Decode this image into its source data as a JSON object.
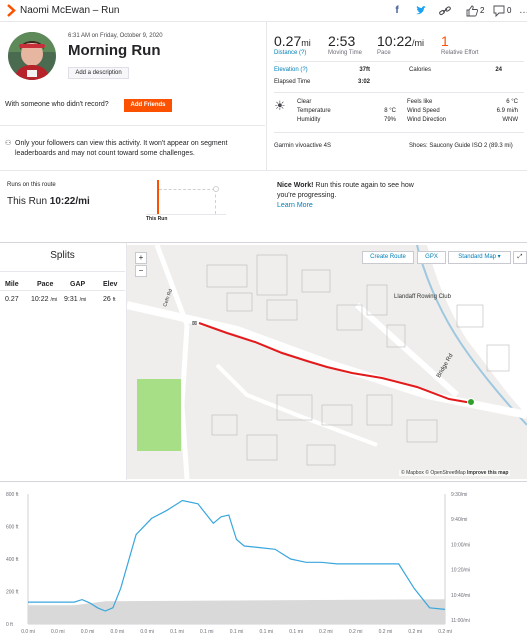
{
  "header": {
    "title": "Naomi McEwan – Run",
    "kudos_count": "2",
    "comment_count": "0"
  },
  "activity": {
    "datetime": "6:31 AM on Friday, October 9, 2020",
    "title": "Morning Run",
    "add_description": "Add a description",
    "with_someone": "With someone who didn't record?",
    "add_friends": "Add Friends",
    "privacy_note": "Only your followers can view this activity. It won't appear on segment leaderboards and may not count toward some challenges."
  },
  "stats": {
    "distance_value": "0.27",
    "distance_unit": "mi",
    "distance_label": "Distance (?)",
    "moving_time_value": "2:53",
    "moving_time_label": "Moving Time",
    "pace_value": "10:22",
    "pace_unit": "/mi",
    "pace_label": "Pace",
    "effort_value": "1",
    "effort_label": "Relative Effort",
    "elevation_label": "Elevation (?)",
    "elevation_value": "37ft",
    "calories_label": "Calories",
    "calories_value": "24",
    "elapsed_label": "Elapsed Time",
    "elapsed_value": "3:02"
  },
  "weather": {
    "condition": "Clear",
    "temperature_label": "Temperature",
    "temperature_value": "8 °C",
    "humidity_label": "Humidity",
    "humidity_value": "79%",
    "feels_label": "Feels like",
    "feels_value": "6 °C",
    "wind_speed_label": "Wind Speed",
    "wind_speed_value": "6.9 mi/h",
    "wind_dir_label": "Wind Direction",
    "wind_dir_value": "WNW",
    "icon": "weather-icon"
  },
  "gear": {
    "device": "Garmin vívoactive 4S",
    "shoes": "Shoes: Saucony Guide ISO 2 (89.3 mi)"
  },
  "route_compare": {
    "runs_on_route": "Runs on this route",
    "this_run_label": "This Run",
    "this_run_pace": "10:22/mi",
    "bar_label": "This Run",
    "nice_work_bold": "Nice Work!",
    "nice_work_text": "Run this route again to see how you're progressing.",
    "learn_more": "Learn More"
  },
  "splits": {
    "title": "Splits",
    "headers": [
      "Mile",
      "Pace",
      "GAP",
      "Elev"
    ],
    "rows": [
      {
        "mile": "0.27",
        "pace": "10:22",
        "pace_unit": "/mi",
        "gap": "9:31",
        "gap_unit": "/mi",
        "elev": "26",
        "elev_unit": "ft"
      }
    ]
  },
  "map": {
    "create_route": "Create Route",
    "gpx": "GPX",
    "map_type": "Standard Map",
    "zoom_in": "+",
    "zoom_out": "−",
    "labels": {
      "road1": "Cefn Rd",
      "road2": "Bridge Rd",
      "club": "Llandaff Rowing Club"
    },
    "attribution": "© Mapbox © OpenStreetMap",
    "improve": "Improve this map"
  },
  "chart_data": {
    "type": "area",
    "title": "",
    "series": [
      {
        "name": "",
        "x": [
          0.0,
          0.01,
          0.02,
          0.03,
          0.035,
          0.04,
          0.045,
          0.05,
          0.055,
          0.06,
          0.07,
          0.08,
          0.09,
          0.1,
          0.11,
          0.12,
          0.125,
          0.13,
          0.135,
          0.14,
          0.15,
          0.16,
          0.17,
          0.18,
          0.19,
          0.2,
          0.21,
          0.22,
          0.23,
          0.24,
          0.25,
          0.26,
          0.27
        ],
        "values": [
          135,
          135,
          135,
          135,
          150,
          130,
          100,
          80,
          100,
          220,
          550,
          650,
          700,
          760,
          740,
          620,
          660,
          670,
          520,
          480,
          470,
          460,
          400,
          380,
          380,
          370,
          370,
          370,
          370,
          370,
          220,
          100,
          90
        ]
      }
    ],
    "left_axis": {
      "unit": "ft",
      "ticks": [
        "0 ft",
        "200 ft",
        "400 ft",
        "600 ft",
        "800 ft"
      ],
      "ylim": [
        0,
        800
      ]
    },
    "right_axis": {
      "unit": "/mi",
      "ticks": [
        "9:30/mi",
        "9:40/mi",
        "10:00/mi",
        "10:20/mi",
        "10:40/mi",
        "11:00/mi"
      ]
    },
    "x_ticks": [
      "0.0 mi",
      "0.0 mi",
      "0.0 mi",
      "0.0 mi",
      "0.0 mi",
      "0.1 mi",
      "0.1 mi",
      "0.1 mi",
      "0.1 mi",
      "0.1 mi",
      "0.2 mi",
      "0.2 mi",
      "0.2 mi",
      "0.2 mi",
      "0.2 mi"
    ],
    "elevation_floor_ft": 140
  },
  "colors": {
    "brand": "#fc5200",
    "link": "#007fb6",
    "route": "#e31a1c",
    "pace_line": "#3aa6dd",
    "elevation_fill": "#d9d9d9"
  }
}
